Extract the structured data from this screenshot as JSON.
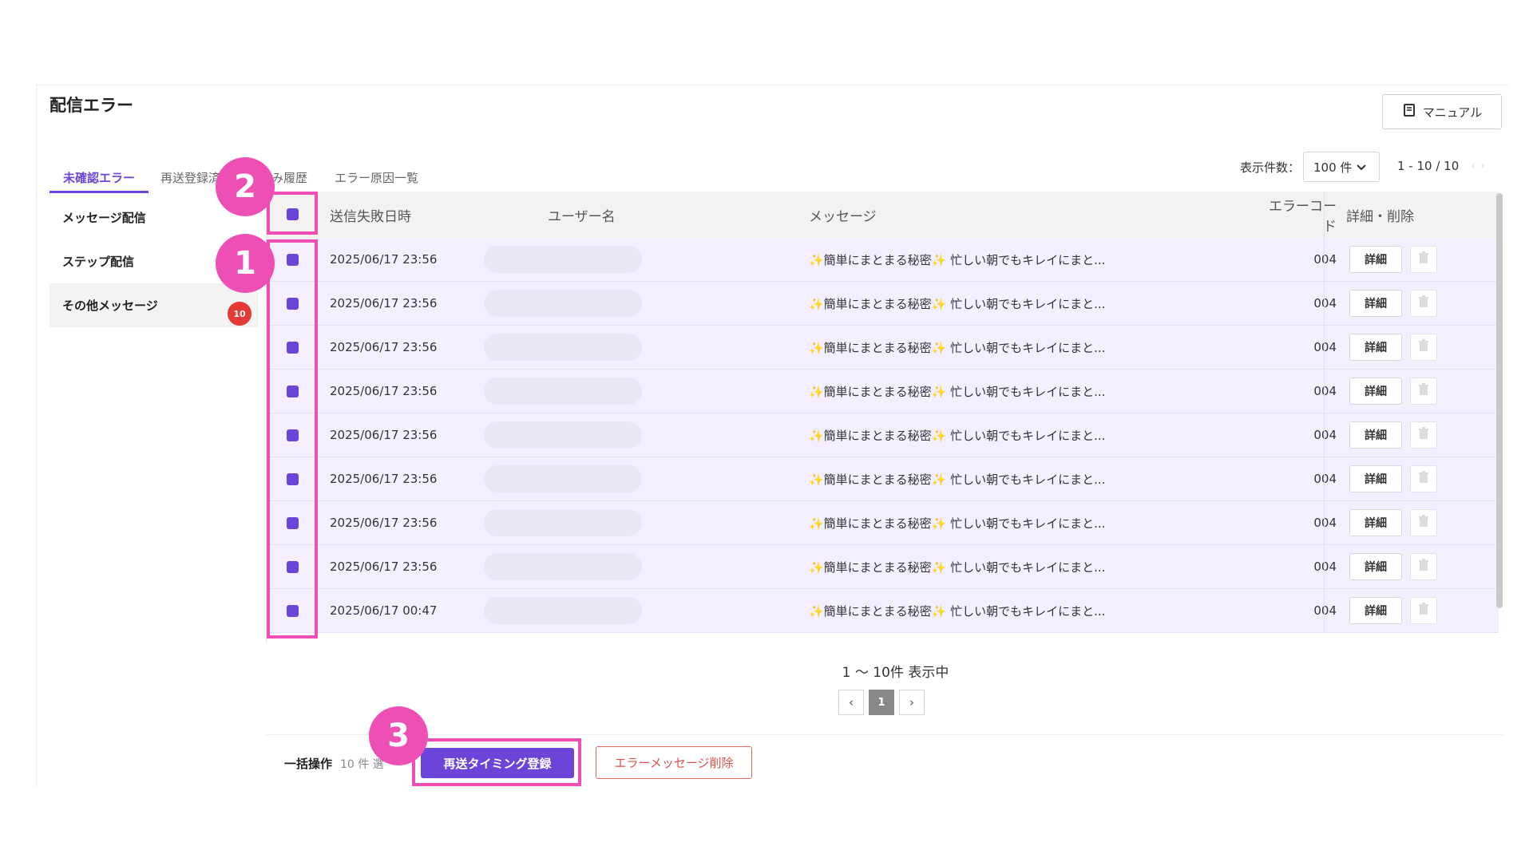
{
  "page": {
    "title": "配信エラー",
    "manual_label": "マニュアル"
  },
  "tabs": [
    {
      "label": "未確認エラー"
    },
    {
      "label": "再送登録済"
    },
    {
      "label": "送済み履歴"
    },
    {
      "label": "エラー原因一覧"
    }
  ],
  "pagination_top": {
    "per_page_label": "表示件数：",
    "per_page_value": "100 件",
    "range": "1 - 10 / 10"
  },
  "sidebar": {
    "items": [
      {
        "label": "メッセージ配信"
      },
      {
        "label": "ステップ配信"
      },
      {
        "label": "その他メッセージ",
        "badge": "10"
      }
    ]
  },
  "table": {
    "headers": {
      "date": "送信失敗日時",
      "user": "ユーザー名",
      "message": "メッセージ",
      "code": "エラーコード",
      "actions": "詳細・削除"
    },
    "detail_label": "詳細",
    "rows": [
      {
        "date": "2025/06/17 23:56",
        "message": "✨簡単にまとまる秘密✨ 忙しい朝でもキレイにまと...",
        "code": "004"
      },
      {
        "date": "2025/06/17 23:56",
        "message": "✨簡単にまとまる秘密✨ 忙しい朝でもキレイにまと...",
        "code": "004"
      },
      {
        "date": "2025/06/17 23:56",
        "message": "✨簡単にまとまる秘密✨ 忙しい朝でもキレイにまと...",
        "code": "004"
      },
      {
        "date": "2025/06/17 23:56",
        "message": "✨簡単にまとまる秘密✨ 忙しい朝でもキレイにまと...",
        "code": "004"
      },
      {
        "date": "2025/06/17 23:56",
        "message": "✨簡単にまとまる秘密✨ 忙しい朝でもキレイにまと...",
        "code": "004"
      },
      {
        "date": "2025/06/17 23:56",
        "message": "✨簡単にまとまる秘密✨ 忙しい朝でもキレイにまと...",
        "code": "004"
      },
      {
        "date": "2025/06/17 23:56",
        "message": "✨簡単にまとまる秘密✨ 忙しい朝でもキレイにまと...",
        "code": "004"
      },
      {
        "date": "2025/06/17 23:56",
        "message": "✨簡単にまとまる秘密✨ 忙しい朝でもキレイにまと...",
        "code": "004"
      },
      {
        "date": "2025/06/17 00:47",
        "message": "✨簡単にまとまる秘密✨ 忙しい朝でもキレイにまと...",
        "code": "004"
      }
    ]
  },
  "pagination_bottom": {
    "showing": "1 〜 10件 表示中",
    "prev": "‹",
    "current": "1",
    "next": "›"
  },
  "bulk": {
    "label": "一括操作",
    "count": "10 件 選",
    "resend_label": "再送タイミング登録",
    "delete_label": "エラーメッセージ削除"
  },
  "markers": [
    {
      "number": "1"
    },
    {
      "number": "2"
    },
    {
      "number": "3"
    }
  ],
  "colors": {
    "accent": "#6b45d8",
    "highlight": "#ee4fb5",
    "badge": "#e53935",
    "row_bg": "#f3efff"
  }
}
